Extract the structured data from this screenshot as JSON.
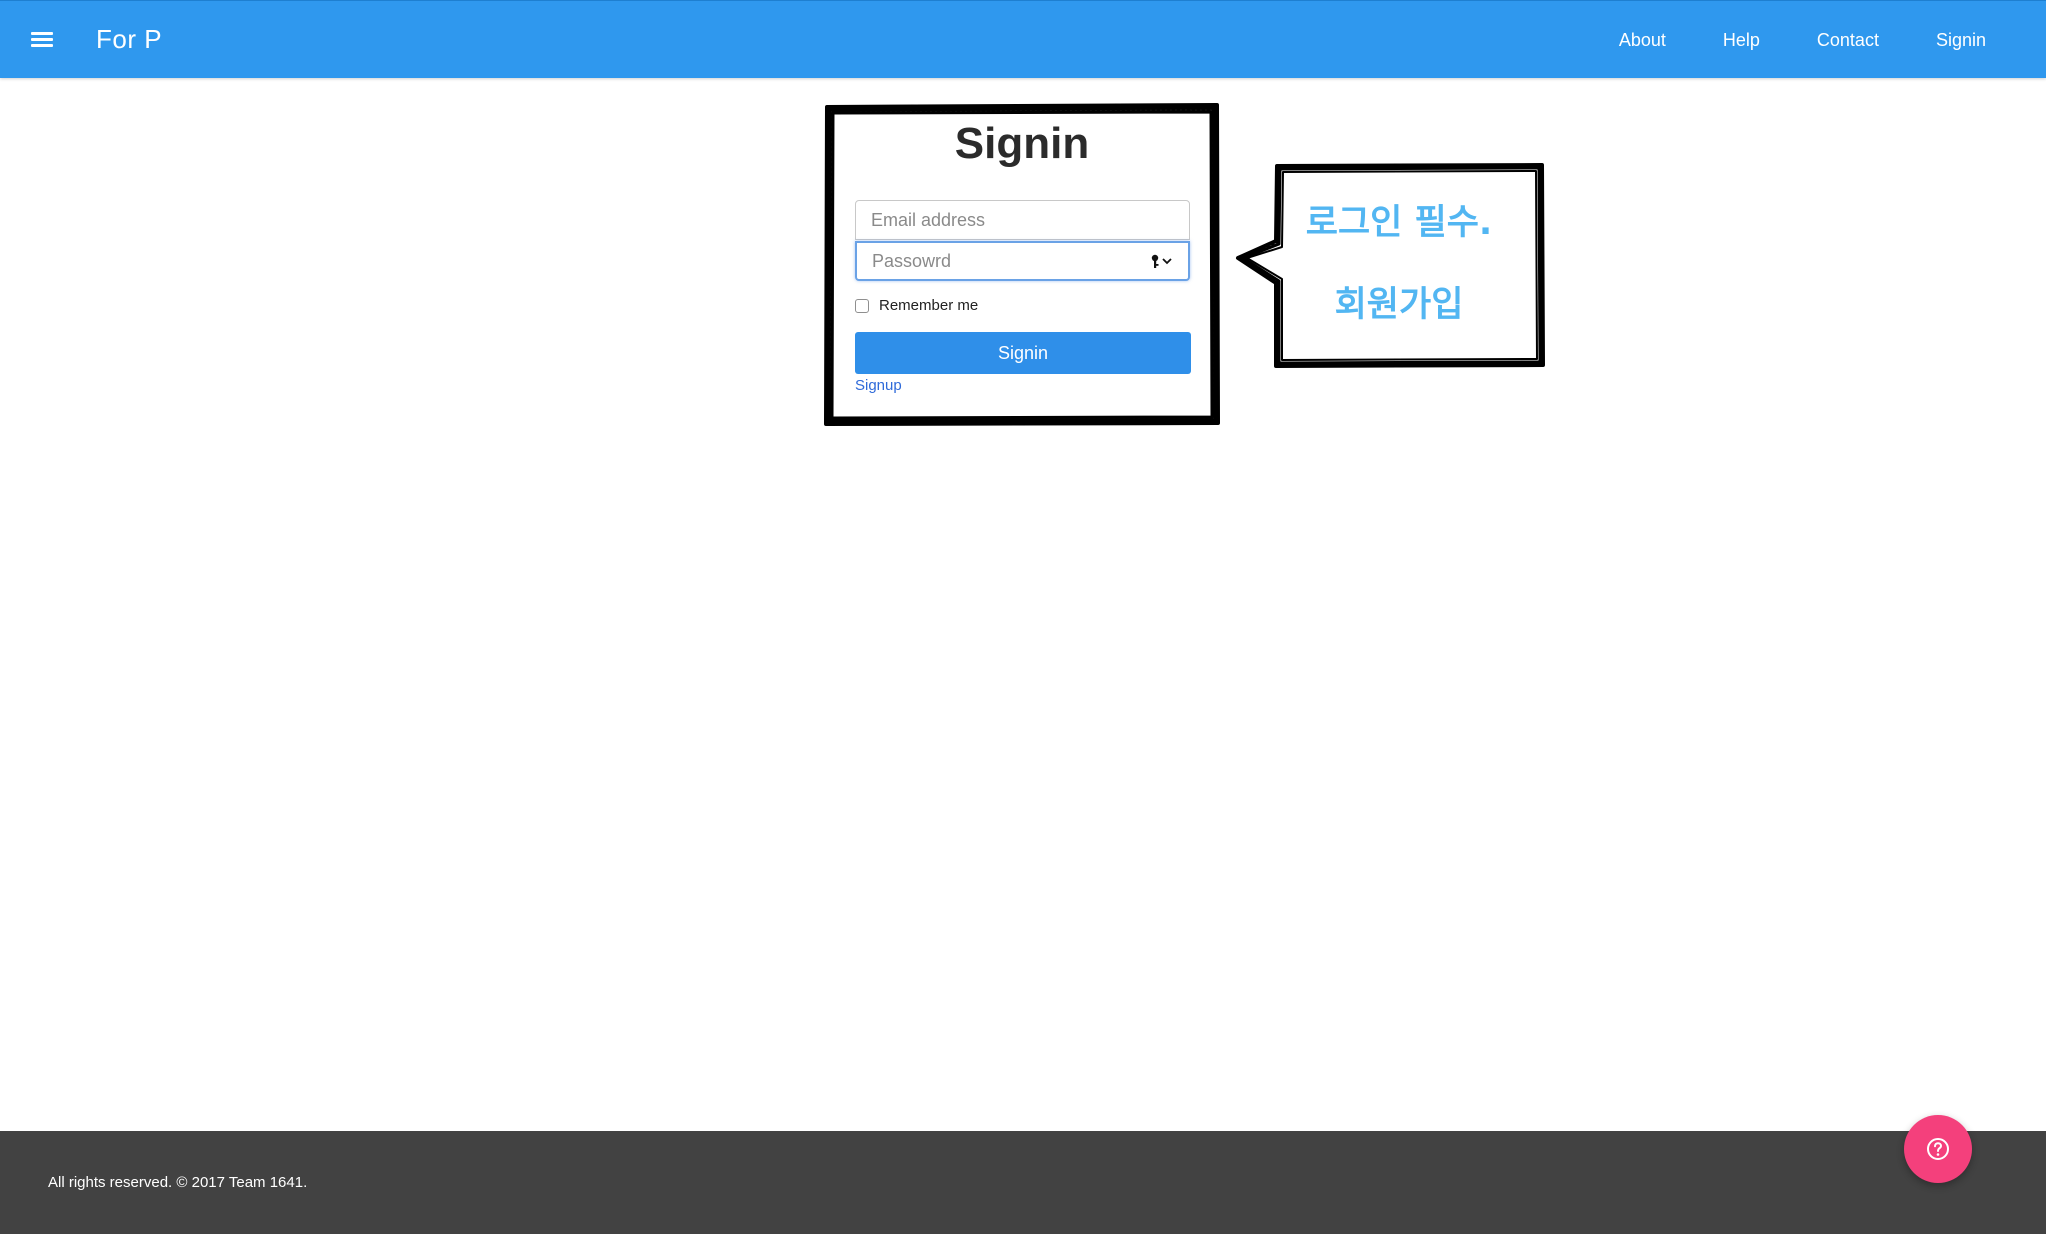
{
  "navbar": {
    "menu_icon": "hamburger-menu-icon",
    "brand": "For P",
    "links": [
      "About",
      "Help",
      "Contact",
      "Signin"
    ],
    "background": "#2f98ee"
  },
  "signin_form": {
    "title": "Signin",
    "email_placeholder": "Email address",
    "password_placeholder": "Passowrd",
    "password_icon": "key-icon",
    "remember_label": "Remember me",
    "remember_checked": false,
    "submit_label": "Signin",
    "signup_link": "Signup",
    "button_color": "#2f8fe9"
  },
  "callout": {
    "line1": "로그인 필수.",
    "line2": "회원가입",
    "text_color": "#52b6f2"
  },
  "footer": {
    "text": "All rights reserved. © 2017 Team 1641.",
    "background": "#424242"
  },
  "help_button": {
    "icon": "question-circle-icon",
    "color": "#f4407c"
  }
}
